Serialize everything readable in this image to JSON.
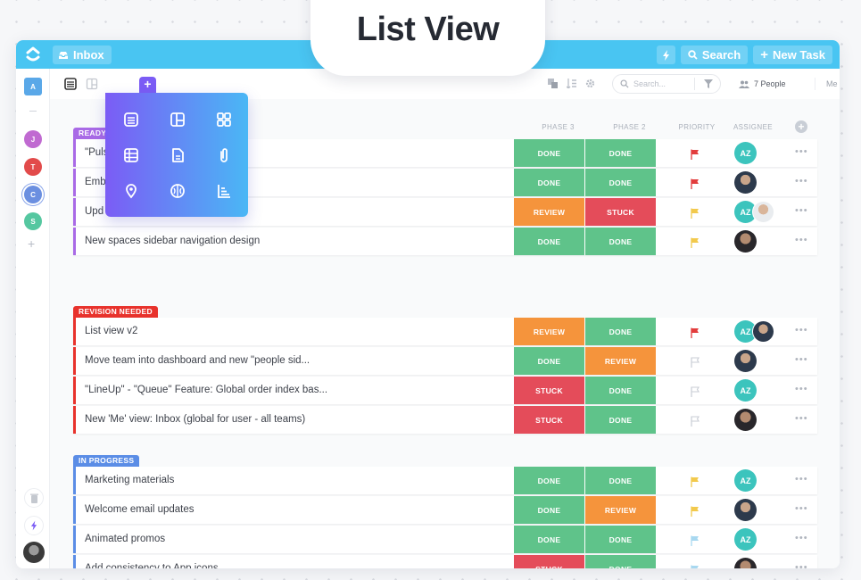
{
  "banner": {
    "title": "List View"
  },
  "topbar": {
    "inbox_label": "Inbox",
    "search_label": "Search",
    "new_task_label": "New Task",
    "color": "#49c5f2"
  },
  "leftbar": {
    "workspace": "A",
    "members": [
      {
        "initial": "J",
        "color": "#c06ad1"
      },
      {
        "initial": "T",
        "color": "#e24b4b"
      },
      {
        "initial": "C",
        "color": "#6b8fe0"
      },
      {
        "initial": "S",
        "color": "#55c7a0"
      }
    ]
  },
  "toolbar": {
    "search_placeholder": "Search...",
    "people_label": "7 People",
    "me_label": "Me"
  },
  "columns": {
    "phase3": "PHASE 3",
    "phase2": "PHASE 2",
    "priority": "PRIORITY",
    "assignee": "ASSIGNEE"
  },
  "popup_menu": {
    "icons": [
      "list-view-icon",
      "board-view-icon",
      "box-view-icon",
      "table-view-icon",
      "doc-view-icon",
      "attachment-icon",
      "map-pin-icon",
      "mind-map-icon",
      "gantt-chart-icon"
    ]
  },
  "status_colors": {
    "DONE": "#5fc38a",
    "REVIEW": "#f5943c",
    "STUCK": "#e44c5a"
  },
  "priority_colors": {
    "urgent": "#e23c3c",
    "normal": "#f2c94c",
    "low": "#a8d8f0",
    "none": "#c9cdd4"
  },
  "groups": [
    {
      "label": "READY",
      "color": "#a96ae6",
      "tasks": [
        {
          "name": "\"Puls",
          "phase3": "DONE",
          "phase2": "DONE",
          "priority": "urgent",
          "assignees": [
            "AZ"
          ]
        },
        {
          "name": "Emb",
          "phase3": "DONE",
          "phase2": "DONE",
          "priority": "urgent",
          "assignees": [
            "photo1"
          ]
        },
        {
          "name": "Upd",
          "phase3": "REVIEW",
          "phase2": "STUCK",
          "priority": "normal",
          "assignees": [
            "AZ",
            "photo2"
          ]
        },
        {
          "name": "New spaces sidebar navigation design",
          "phase3": "DONE",
          "phase2": "DONE",
          "priority": "normal",
          "assignees": [
            "photo3"
          ]
        }
      ]
    },
    {
      "label": "REVISION NEEDED",
      "color": "#e8322c",
      "tasks": [
        {
          "name": "List view v2",
          "phase3": "REVIEW",
          "phase2": "DONE",
          "priority": "urgent",
          "assignees": [
            "AZ",
            "photo1"
          ]
        },
        {
          "name": "Move team into dashboard and new \"people sid...",
          "phase3": "DONE",
          "phase2": "REVIEW",
          "priority": "none",
          "assignees": [
            "photo1"
          ]
        },
        {
          "name": "\"LineUp\" - \"Queue\" Feature: Global order index bas...",
          "phase3": "STUCK",
          "phase2": "DONE",
          "priority": "none",
          "assignees": [
            "AZ"
          ]
        },
        {
          "name": "New 'Me' view: Inbox (global for user - all teams)",
          "phase3": "STUCK",
          "phase2": "DONE",
          "priority": "none",
          "assignees": [
            "photo3"
          ]
        }
      ]
    },
    {
      "label": "IN PROGRESS",
      "color": "#5b8de6",
      "tasks": [
        {
          "name": "Marketing  materials",
          "phase3": "DONE",
          "phase2": "DONE",
          "priority": "normal",
          "assignees": [
            "AZ"
          ]
        },
        {
          "name": "Welcome email updates",
          "phase3": "DONE",
          "phase2": "REVIEW",
          "priority": "normal",
          "assignees": [
            "photo1"
          ]
        },
        {
          "name": "Animated promos",
          "phase3": "DONE",
          "phase2": "DONE",
          "priority": "low",
          "assignees": [
            "AZ"
          ]
        },
        {
          "name": "Add consistency to App icons",
          "phase3": "STUCK",
          "phase2": "DONE",
          "priority": "low",
          "assignees": [
            "photo3"
          ]
        }
      ]
    }
  ]
}
